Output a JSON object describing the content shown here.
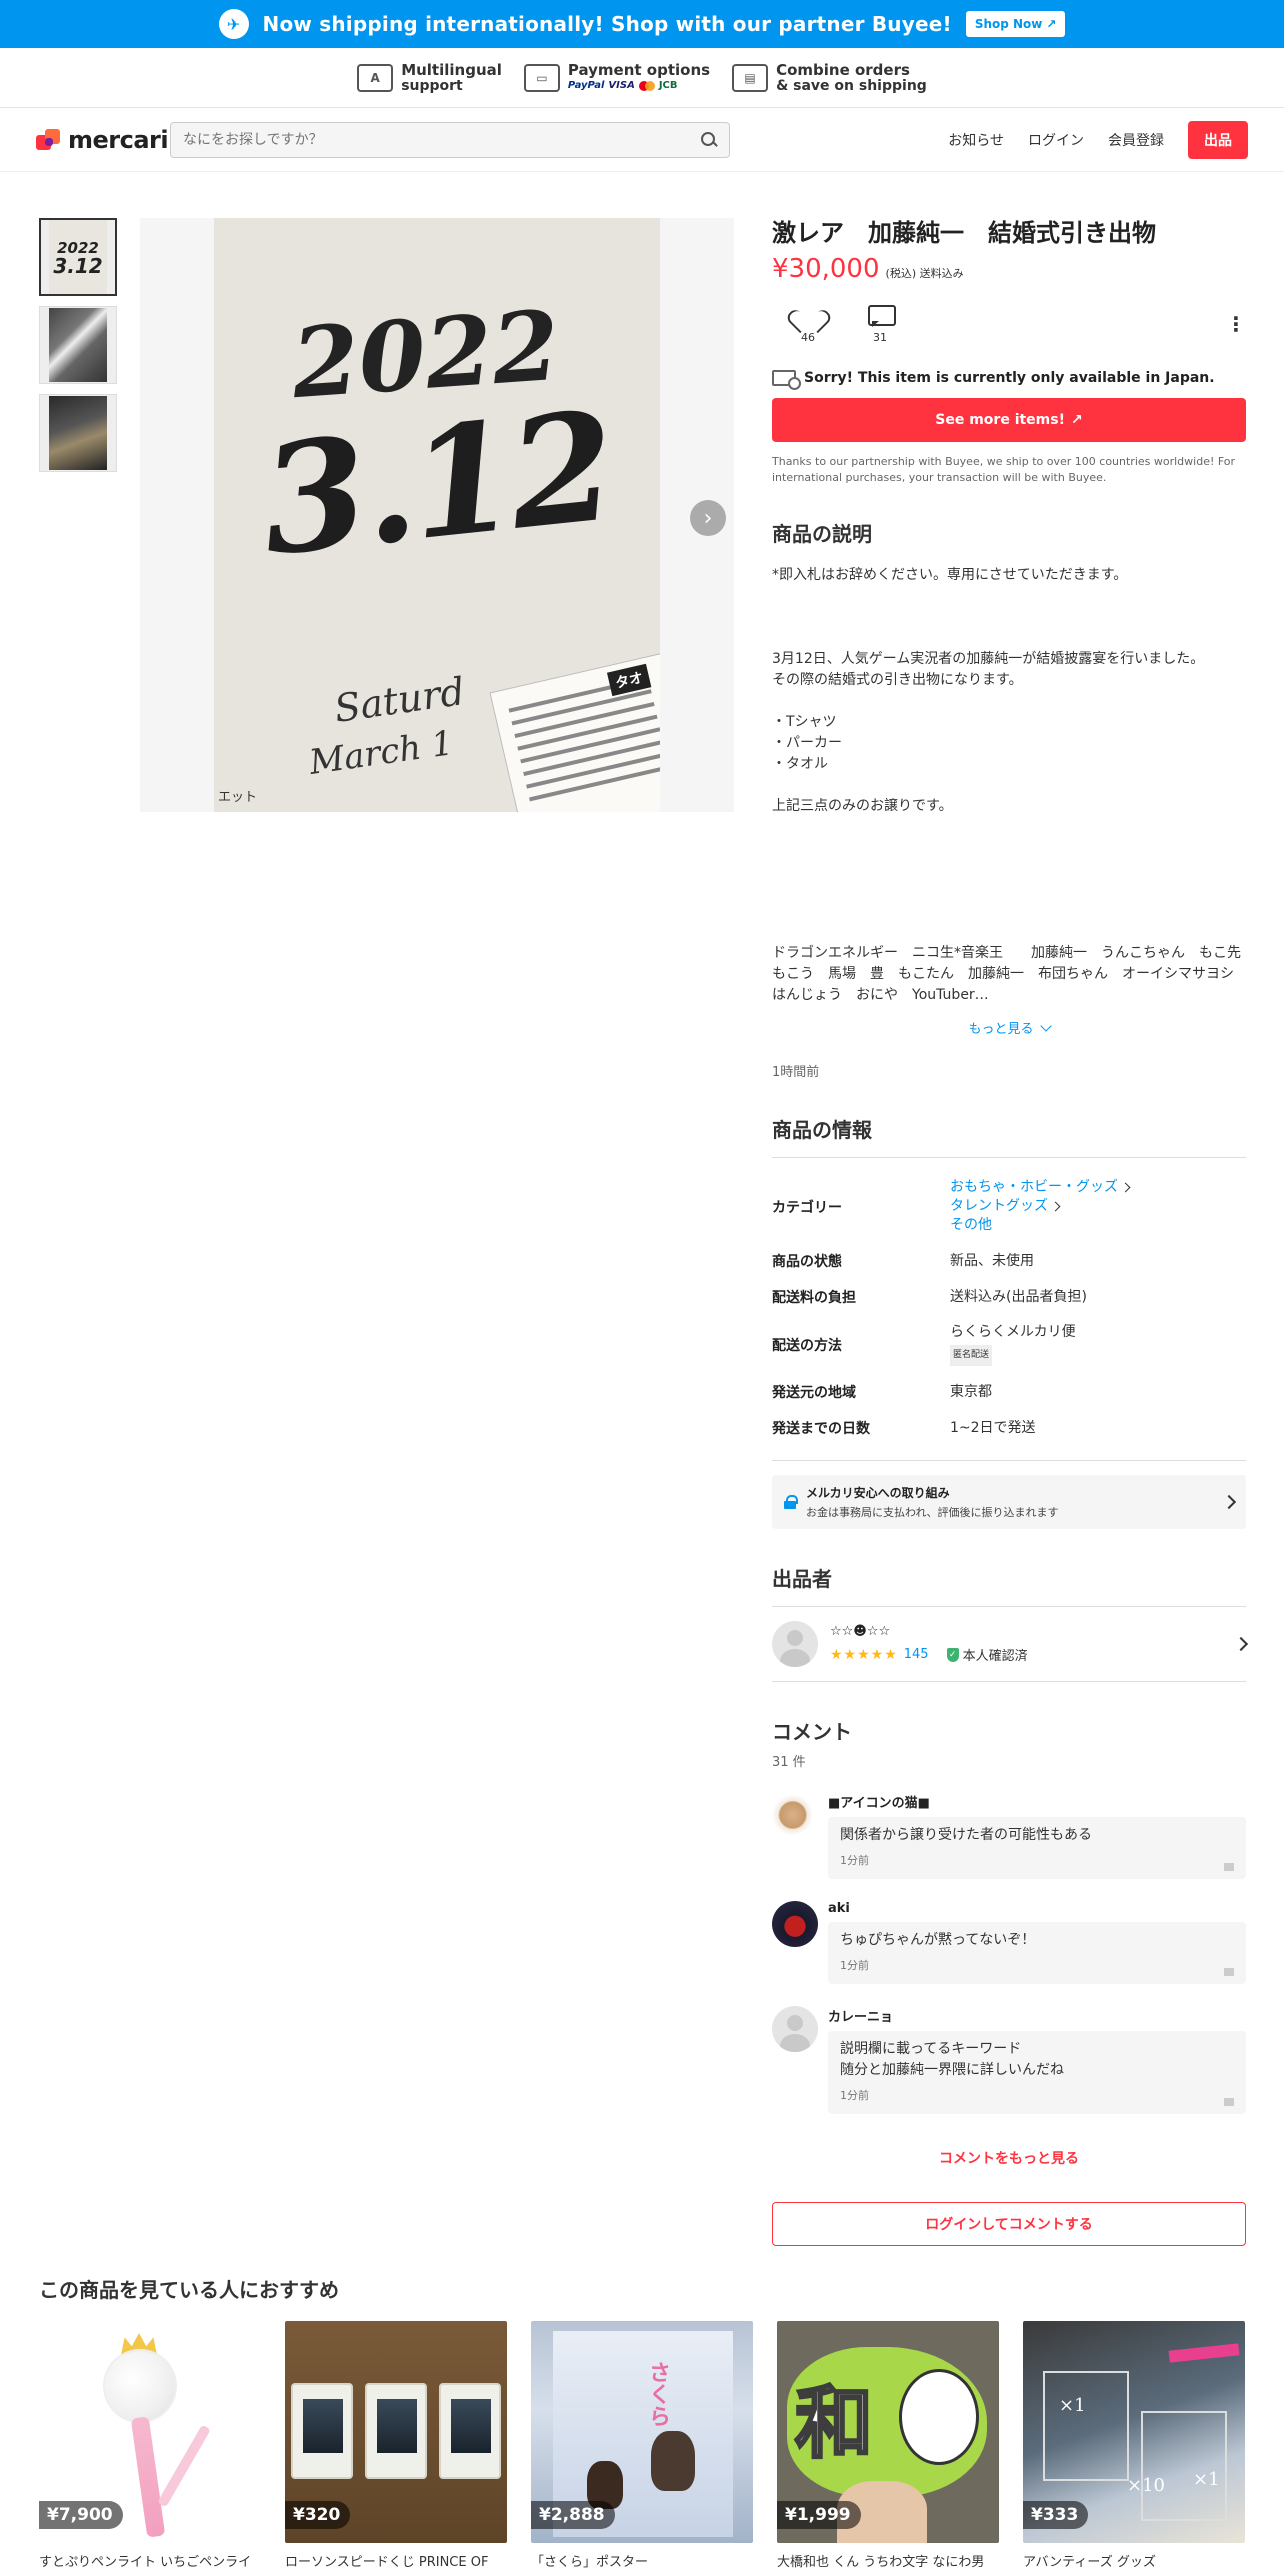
{
  "promo": {
    "message": "Now shipping internationally! Shop with our partner Buyee!",
    "button": "Shop Now"
  },
  "features": [
    {
      "icon": "translate-icon",
      "line1": "Multilingual",
      "line2": "support"
    },
    {
      "icon": "card-icon",
      "line1": "Payment options",
      "line2": ""
    },
    {
      "icon": "box-icon",
      "line1": "Combine orders",
      "line2": "& save on shipping"
    }
  ],
  "payment_marks": [
    "PayPal",
    "VISA",
    "JCB"
  ],
  "header": {
    "logo": "mercari",
    "search_placeholder": "なにをお探しですか？",
    "nav": [
      "お知らせ",
      "ログイン",
      "会員登録"
    ],
    "sell": "出品"
  },
  "gallery": {
    "thumb1_text": [
      "2022",
      "3.12"
    ],
    "photo": {
      "year": "2022",
      "date": "3.12",
      "line1": "Saturd",
      "line2": "March 1",
      "tag": "タオ",
      "corner": "エット"
    }
  },
  "item": {
    "title": "激レア　加藤純一　結婚式引き出物",
    "price": "¥30,000",
    "price_note": "(税込) 送料込み",
    "likes": "46",
    "comments": "31",
    "unavailable": "Sorry! This item is currently only available in Japan.",
    "see_more": "See more items!",
    "buyee_note": "Thanks to our partnership with Buyee, we ship to over 100 countries worldwide! For international purchases, your transaction will be with Buyee."
  },
  "description": {
    "heading": "商品の説明",
    "lines": [
      "*即入札はお辞めください。専用にさせていただきます。",
      "",
      "",
      "",
      "3月12日、人気ゲーム実況者の加藤純一が結婚披露宴を行いました。",
      "その際の結婚式の引き出物になります。",
      "",
      "・Tシャツ",
      "・パーカー",
      "・タオル",
      "",
      "上記三点のみのお譲りです。",
      "",
      "",
      "",
      "",
      "",
      ""
    ],
    "tags": "ドラゴンエネルギー　ニコ生*音楽王　　加藤純一　うんこちゃん　もこ先　もこう　馬場　豊　もこたん　加藤純一　布団ちゃん　オーイシマサヨシ　はんじょう　おにや　YouTuber…",
    "more": "もっと見る",
    "time_ago": "1時間前"
  },
  "info": {
    "heading": "商品の情報",
    "category_label": "カテゴリー",
    "categories": [
      "おもちゃ・ホビー・グッズ",
      "タレントグッズ",
      "その他"
    ],
    "rows": [
      {
        "k": "商品の状態",
        "v": "新品、未使用"
      },
      {
        "k": "配送料の負担",
        "v": "送料込み(出品者負担)"
      }
    ],
    "shipping_method_label": "配送の方法",
    "shipping_method": "らくらくメルカリ便",
    "anon_badge": "匿名配送",
    "rows2": [
      {
        "k": "発送元の地域",
        "v": "東京都"
      },
      {
        "k": "発送までの日数",
        "v": "1~2日で発送"
      }
    ]
  },
  "safety": {
    "title": "メルカリ安心への取り組み",
    "sub": "お金は事務局に支払われ、評価後に振り込まれます"
  },
  "seller": {
    "heading": "出品者",
    "name": "☆☆☻☆☆",
    "stars": 5,
    "star_glyphs": "★★★★★",
    "reviews": "145",
    "verified": "本人確認済"
  },
  "comments": {
    "heading": "コメント",
    "count": "31 件",
    "items": [
      {
        "name": "■アイコンの猫■",
        "text": "関係者から譲り受けた者の可能性もある",
        "time": "1分前"
      },
      {
        "name": "aki",
        "text": "ちゅぴちゃんが黙ってないぞ！",
        "time": "1分前"
      },
      {
        "name": "カレーニョ",
        "text1": "説明欄に載ってるキーワード",
        "text2": "随分と加藤純一界隈に詳しいんだね",
        "time": "1分前"
      }
    ],
    "more": "コメントをもっと見る",
    "login": "ログインしてコメントする"
  },
  "recommend": {
    "heading": "この商品を見ている人におすすめ",
    "items": [
      {
        "price": "¥7,900",
        "name": "すとぷりペンライト いちごペンライ"
      },
      {
        "price": "¥320",
        "name": "ローソンスピードくじ PRINCE OF"
      },
      {
        "price": "¥2,888",
        "name": "「さくら」ポスター",
        "poster_title": "さくら"
      },
      {
        "price": "¥1,999",
        "name": "大橋和也 くん うちわ文字 なにわ男",
        "fan_char": "和"
      },
      {
        "price": "¥333",
        "name": "アバンティーズ グッズ"
      }
    ]
  }
}
